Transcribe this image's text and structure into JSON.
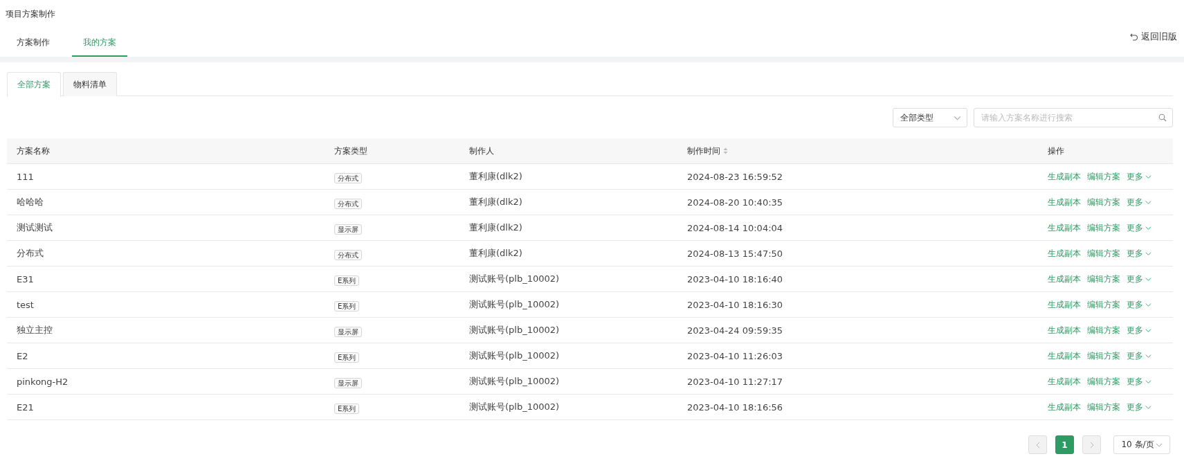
{
  "page_title": "项目方案制作",
  "top_tabs": [
    {
      "label": "方案制作",
      "selected": false
    },
    {
      "label": "我的方案",
      "selected": true
    }
  ],
  "back_link": "返回旧版",
  "sub_tabs": [
    {
      "label": "全部方案",
      "selected": true
    },
    {
      "label": "物料清单",
      "selected": false
    }
  ],
  "type_filter": {
    "value": "全部类型"
  },
  "search": {
    "placeholder": "请输入方案名称进行搜索"
  },
  "table": {
    "columns": [
      {
        "label": "方案名称",
        "sortable": false
      },
      {
        "label": "方案类型",
        "sortable": false
      },
      {
        "label": "制作人",
        "sortable": false
      },
      {
        "label": "制作时间",
        "sortable": true
      },
      {
        "label": "操作",
        "sortable": false
      }
    ],
    "rows": [
      {
        "name": "111",
        "type": "分布式",
        "creator": "董利康(dlk2)",
        "time": "2024-08-23 16:59:52",
        "actions": [
          "生成副本",
          "编辑方案",
          "更多"
        ]
      },
      {
        "name": "哈哈哈",
        "type": "分布式",
        "creator": "董利康(dlk2)",
        "time": "2024-08-20 10:40:35",
        "actions": [
          "生成副本",
          "编辑方案",
          "更多"
        ]
      },
      {
        "name": "测试测试",
        "type": "显示屏",
        "creator": "董利康(dlk2)",
        "time": "2024-08-14 10:04:04",
        "actions": [
          "生成副本",
          "编辑方案",
          "更多"
        ]
      },
      {
        "name": "分布式",
        "type": "分布式",
        "creator": "董利康(dlk2)",
        "time": "2024-08-13 15:47:50",
        "actions": [
          "生成副本",
          "编辑方案",
          "更多"
        ]
      },
      {
        "name": "E31",
        "type": "E系列",
        "creator": "测试账号(plb_10002)",
        "time": "2023-04-10 18:16:40",
        "actions": [
          "生成副本",
          "编辑方案",
          "更多"
        ]
      },
      {
        "name": "test",
        "type": "E系列",
        "creator": "测试账号(plb_10002)",
        "time": "2023-04-10 18:16:30",
        "actions": [
          "生成副本",
          "编辑方案",
          "更多"
        ]
      },
      {
        "name": "独立主控",
        "type": "显示屏",
        "creator": "测试账号(plb_10002)",
        "time": "2023-04-24 09:59:35",
        "actions": [
          "生成副本",
          "编辑方案",
          "更多"
        ]
      },
      {
        "name": "E2",
        "type": "E系列",
        "creator": "测试账号(plb_10002)",
        "time": "2023-04-10 11:26:03",
        "actions": [
          "生成副本",
          "编辑方案",
          "更多"
        ]
      },
      {
        "name": "pinkong-H2",
        "type": "显示屏",
        "creator": "测试账号(plb_10002)",
        "time": "2023-04-10 11:27:17",
        "actions": [
          "生成副本",
          "编辑方案",
          "更多"
        ]
      },
      {
        "name": "E21",
        "type": "E系列",
        "creator": "测试账号(plb_10002)",
        "time": "2023-04-10 18:16:56",
        "actions": [
          "生成副本",
          "编辑方案",
          "更多"
        ]
      }
    ]
  },
  "pagination": {
    "pages": [
      {
        "label": "1",
        "selected": true
      }
    ],
    "page_size": "10 条/页"
  }
}
